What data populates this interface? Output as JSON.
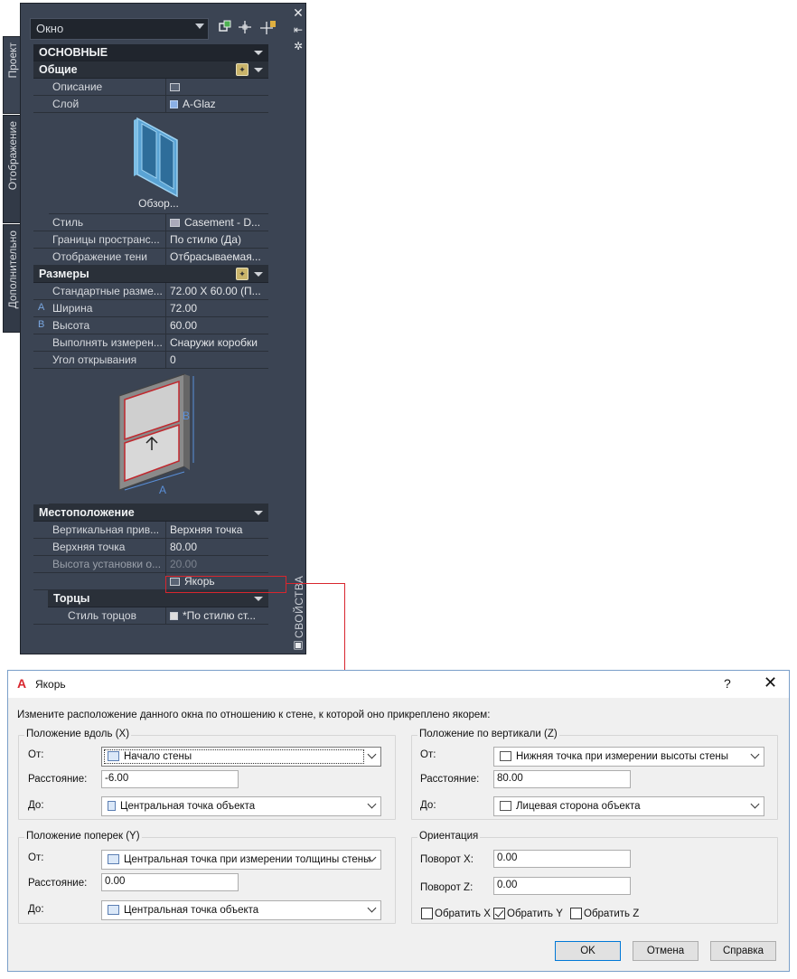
{
  "palette": {
    "type_select": "Окно",
    "tabs": [
      "Проект",
      "Отображение",
      "Дополнительно"
    ],
    "side_label": "СВОЙСТВА",
    "sections": {
      "basic": "ОСНОВНЫЕ",
      "general": {
        "title": "Общие",
        "rows": [
          {
            "name": "Описание",
            "value": ""
          },
          {
            "name": "Слой",
            "value": "A-Glaz"
          }
        ],
        "preview_caption": "Обзор...",
        "rows2": [
          {
            "name": "Стиль",
            "value": "Casement - D..."
          },
          {
            "name": "Границы пространс...",
            "value": "По стилю (Да)"
          },
          {
            "name": "Отображение тени",
            "value": "Отбрасываемая..."
          }
        ]
      },
      "dimensions": {
        "title": "Размеры",
        "rows": [
          {
            "marker": "",
            "name": "Стандартные разме...",
            "value": "72.00 X 60.00 (П..."
          },
          {
            "marker": "A",
            "name": "Ширина",
            "value": "72.00"
          },
          {
            "marker": "B",
            "name": "Высота",
            "value": "60.00"
          },
          {
            "marker": "",
            "name": "Выполнять измерен...",
            "value": "Снаружи коробки"
          },
          {
            "marker": "",
            "name": "Угол открывания",
            "value": "0"
          }
        ],
        "diagram_labels": {
          "a": "A",
          "b": "B"
        }
      },
      "location": {
        "title": "Местоположение",
        "rows": [
          {
            "name": "Вертикальная прив...",
            "value": "Верхняя точка"
          },
          {
            "name": "Верхняя точка",
            "value": "80.00"
          },
          {
            "name": "Высота установки о...",
            "value": "20.00"
          }
        ],
        "anchor_value": "Якорь"
      },
      "ends": {
        "title": "Торцы",
        "rows": [
          {
            "name": "Стиль торцов",
            "value": "*По стилю ст..."
          }
        ]
      }
    }
  },
  "dialog": {
    "title": "Якорь",
    "help": "?",
    "close": "✕",
    "description": "Измените расположение данного окна по отношению к стене, к которой оно прикреплено якорем:",
    "along": {
      "legend": "Положение вдоль (X)",
      "from_label": "От:",
      "from_value": "Начало стены",
      "distance_label": "Расстояние:",
      "distance_value": "-6.00",
      "to_label": "До:",
      "to_value": "Центральная точка объекта"
    },
    "across": {
      "legend": "Положение поперек (Y)",
      "from_label": "От:",
      "from_value": "Центральная точка при измерении толщины стены",
      "distance_label": "Расстояние:",
      "distance_value": "0.00",
      "to_label": "До:",
      "to_value": "Центральная точка объекта"
    },
    "vertical": {
      "legend": "Положение по вертикали (Z)",
      "from_label": "От:",
      "from_value": "Нижняя точка при измерении высоты стены",
      "distance_label": "Расстояние:",
      "distance_value": "80.00",
      "to_label": "До:",
      "to_value": "Лицевая сторона объекта"
    },
    "orientation": {
      "legend": "Ориентация",
      "rot_x_label": "Поворот X:",
      "rot_x_value": "0.00",
      "rot_z_label": "Поворот Z:",
      "rot_z_value": "0.00",
      "flip_x": "Обратить X",
      "flip_x_checked": false,
      "flip_y": "Обратить Y",
      "flip_y_checked": true,
      "flip_z": "Обратить Z",
      "flip_z_checked": false
    },
    "buttons": {
      "ok": "OK",
      "cancel": "Отмена",
      "help": "Справка"
    }
  },
  "colors": {
    "accent_red": "#d8262e",
    "palette_bg": "#3b4453",
    "dialog_border": "#7a9fc9"
  }
}
